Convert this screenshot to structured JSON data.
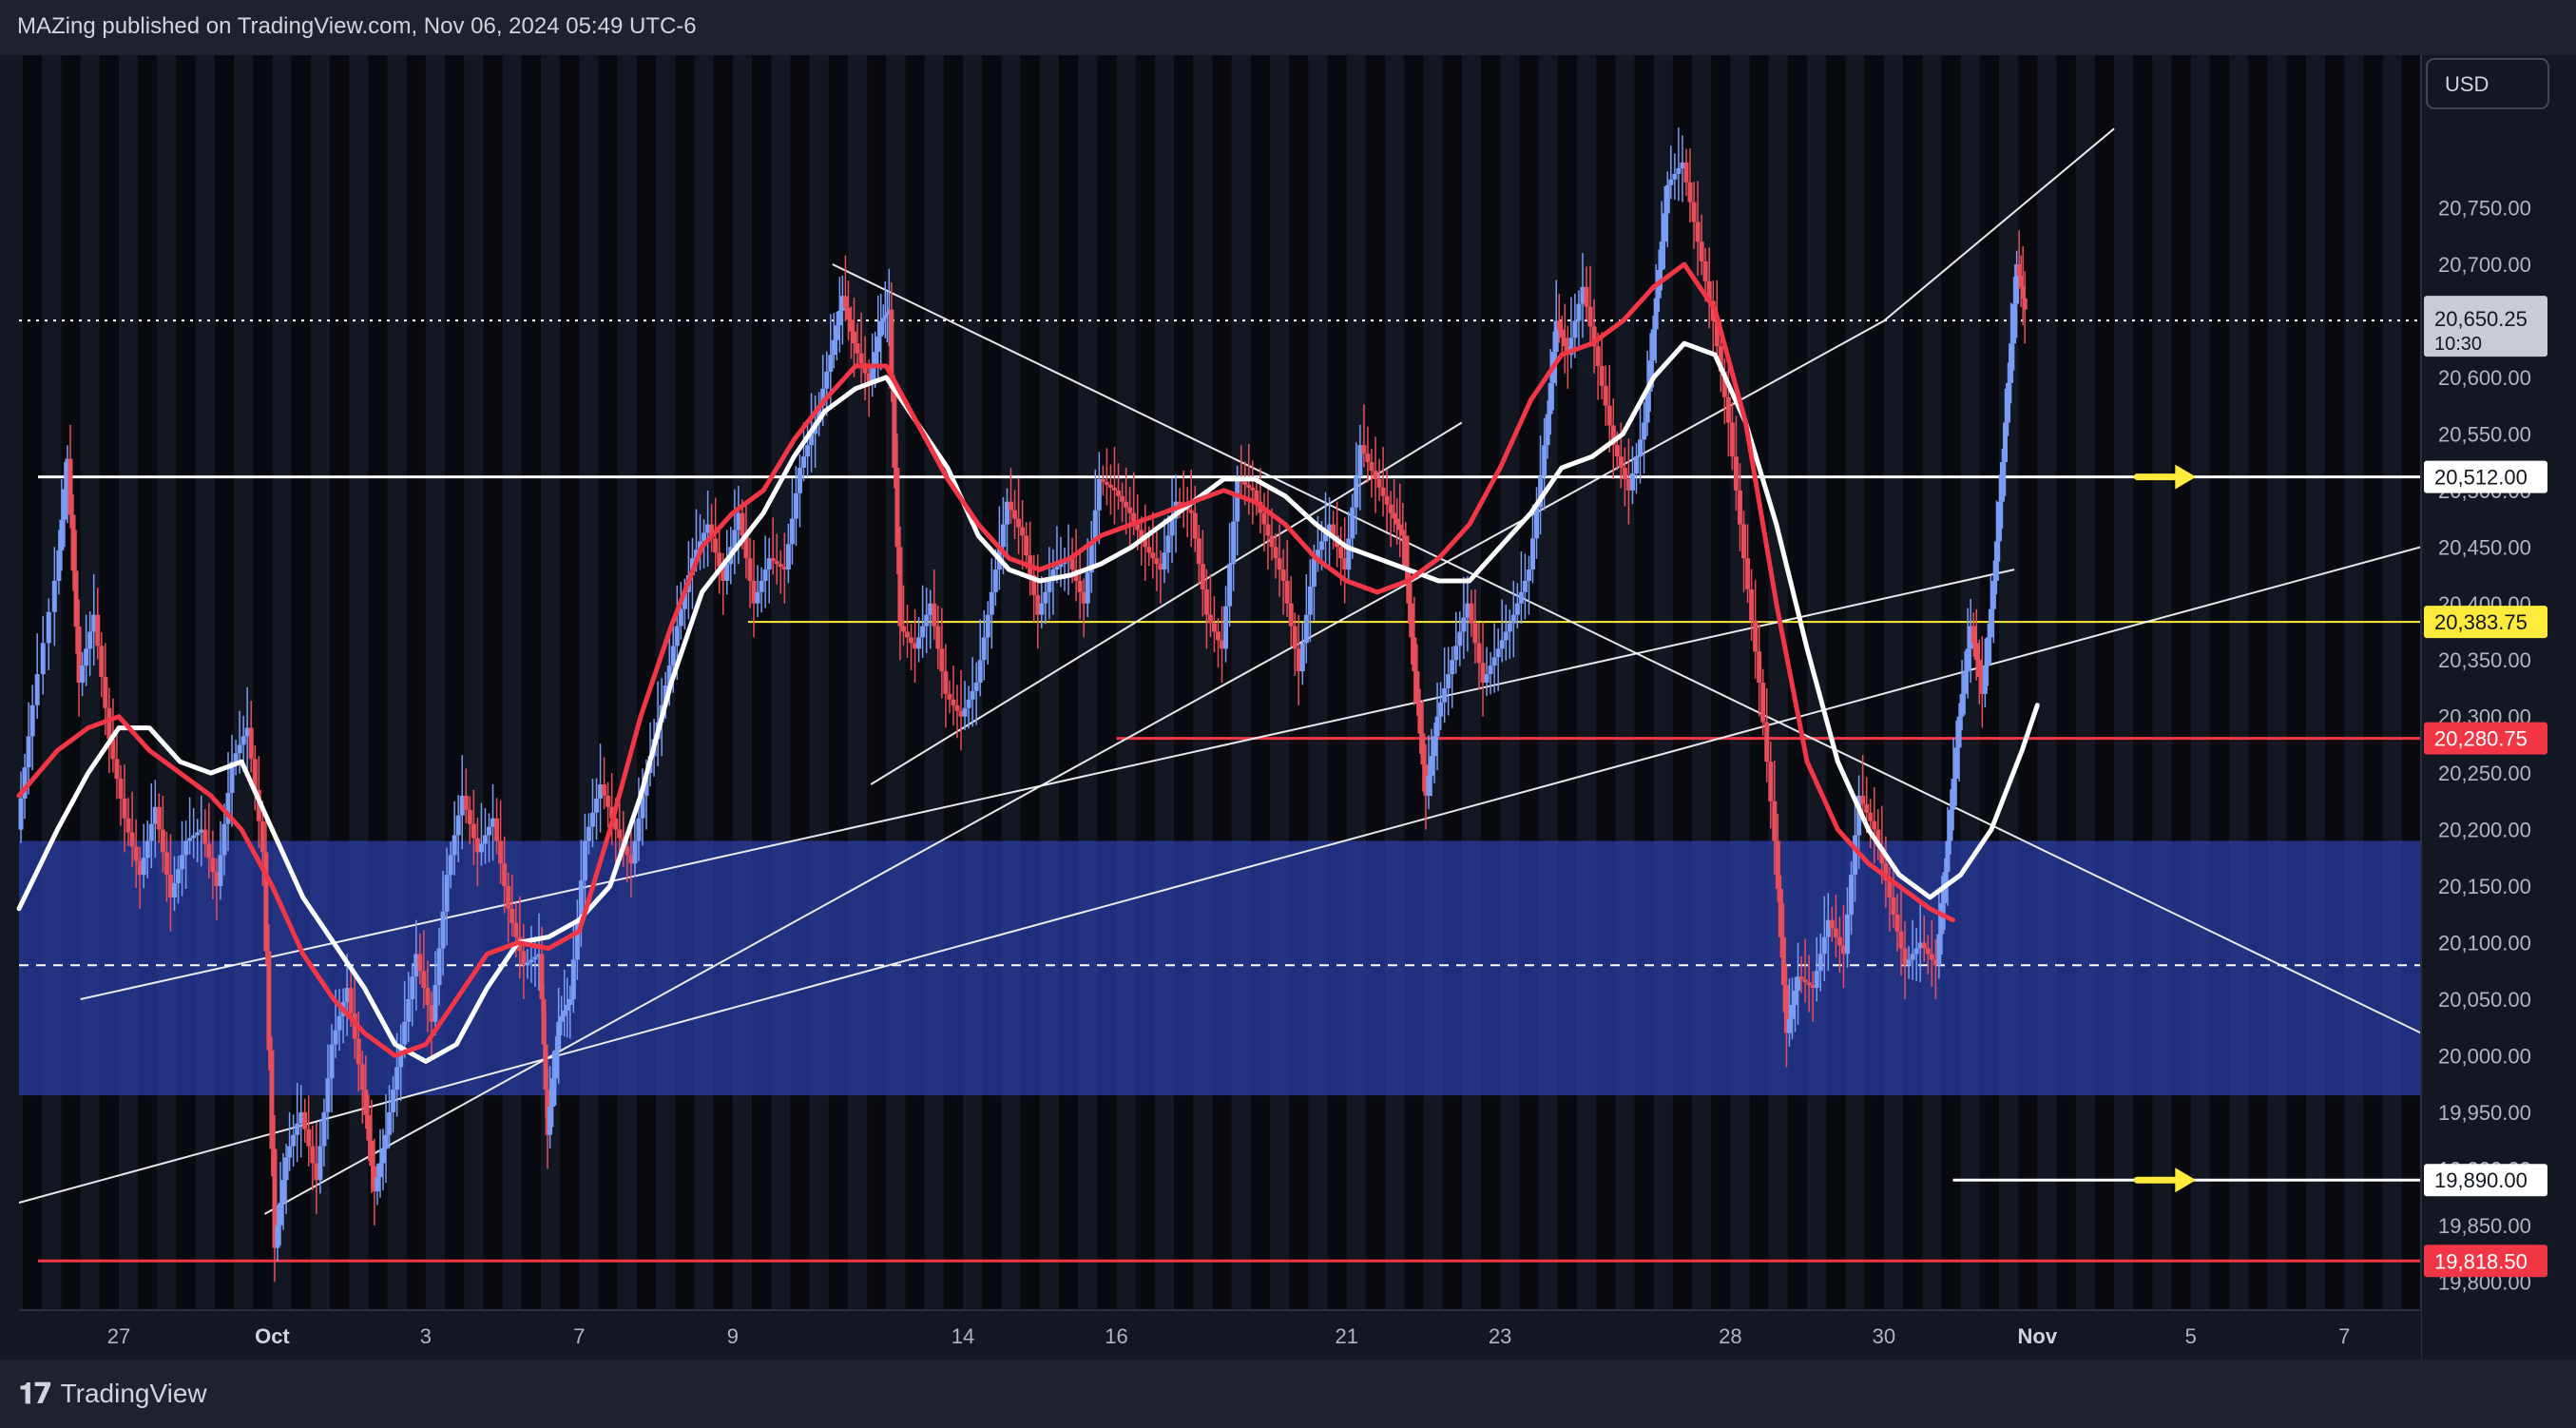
{
  "header": {
    "publisher": "MAZing published on TradingView.com, Nov 06, 2024 05:49 UTC-6"
  },
  "footer": {
    "brand": "TradingView",
    "logo_icon": "tradingview-logo-icon"
  },
  "chart_data": {
    "type": "candlestick",
    "title": "",
    "currency": "USD",
    "xlabel": "",
    "ylabel": "",
    "ylim": [
      19775,
      20885
    ],
    "y_ticks": [
      19800,
      19850,
      19900,
      19950,
      20000,
      20050,
      20100,
      20150,
      20200,
      20250,
      20300,
      20350,
      20400,
      20450,
      20500,
      20550,
      20600,
      20650,
      20700,
      20750
    ],
    "x_ticks": [
      {
        "label": "27",
        "t": 3
      },
      {
        "label": "Oct",
        "t": 5
      },
      {
        "label": "3",
        "t": 7
      },
      {
        "label": "7",
        "t": 9
      },
      {
        "label": "9",
        "t": 11
      },
      {
        "label": "14",
        "t": 14
      },
      {
        "label": "16",
        "t": 16
      },
      {
        "label": "21",
        "t": 19
      },
      {
        "label": "23",
        "t": 21
      },
      {
        "label": "28",
        "t": 24
      },
      {
        "label": "30",
        "t": 26
      },
      {
        "label": "Nov",
        "t": 28
      },
      {
        "label": "5",
        "t": 30
      },
      {
        "label": "7",
        "t": 32
      }
    ],
    "x_range": [
      1.7,
      33
    ],
    "grid": false,
    "session_stripes": true,
    "current_price": {
      "value": "20,650.25",
      "countdown": "10:30",
      "price": 20650.25
    },
    "price_series": [
      [
        1.7,
        20200
      ],
      [
        1.9,
        20310
      ],
      [
        2.2,
        20420
      ],
      [
        2.35,
        20528
      ],
      [
        2.5,
        20330
      ],
      [
        2.7,
        20390
      ],
      [
        2.9,
        20280
      ],
      [
        3.1,
        20210
      ],
      [
        3.3,
        20160
      ],
      [
        3.5,
        20220
      ],
      [
        3.7,
        20140
      ],
      [
        3.9,
        20190
      ],
      [
        4.1,
        20200
      ],
      [
        4.3,
        20150
      ],
      [
        4.5,
        20260
      ],
      [
        4.7,
        20290
      ],
      [
        4.9,
        20180
      ],
      [
        5.05,
        19830
      ],
      [
        5.2,
        19910
      ],
      [
        5.4,
        19950
      ],
      [
        5.6,
        19890
      ],
      [
        5.8,
        20010
      ],
      [
        6.0,
        20060
      ],
      [
        6.2,
        19970
      ],
      [
        6.35,
        19880
      ],
      [
        6.5,
        19930
      ],
      [
        6.7,
        20010
      ],
      [
        6.9,
        20090
      ],
      [
        7.1,
        20030
      ],
      [
        7.3,
        20160
      ],
      [
        7.5,
        20230
      ],
      [
        7.7,
        20180
      ],
      [
        7.9,
        20210
      ],
      [
        8.1,
        20130
      ],
      [
        8.3,
        20080
      ],
      [
        8.5,
        20090
      ],
      [
        8.6,
        19930
      ],
      [
        8.75,
        20030
      ],
      [
        8.9,
        20050
      ],
      [
        9.1,
        20190
      ],
      [
        9.3,
        20240
      ],
      [
        9.5,
        20200
      ],
      [
        9.7,
        20170
      ],
      [
        9.9,
        20250
      ],
      [
        10.1,
        20310
      ],
      [
        10.3,
        20380
      ],
      [
        10.5,
        20440
      ],
      [
        10.7,
        20470
      ],
      [
        10.9,
        20420
      ],
      [
        11.1,
        20480
      ],
      [
        11.3,
        20400
      ],
      [
        11.5,
        20440
      ],
      [
        11.7,
        20430
      ],
      [
        11.9,
        20520
      ],
      [
        12.1,
        20560
      ],
      [
        12.3,
        20620
      ],
      [
        12.45,
        20672
      ],
      [
        12.6,
        20630
      ],
      [
        12.8,
        20595
      ],
      [
        12.95,
        20650
      ],
      [
        13.05,
        20660
      ],
      [
        13.2,
        20380
      ],
      [
        13.4,
        20360
      ],
      [
        13.6,
        20400
      ],
      [
        13.8,
        20320
      ],
      [
        14.0,
        20300
      ],
      [
        14.2,
        20330
      ],
      [
        14.4,
        20410
      ],
      [
        14.6,
        20490
      ],
      [
        14.8,
        20460
      ],
      [
        15.0,
        20390
      ],
      [
        15.2,
        20430
      ],
      [
        15.4,
        20440
      ],
      [
        15.6,
        20400
      ],
      [
        15.8,
        20510
      ],
      [
        16.0,
        20500
      ],
      [
        16.2,
        20480
      ],
      [
        16.4,
        20450
      ],
      [
        16.6,
        20430
      ],
      [
        16.8,
        20490
      ],
      [
        17.0,
        20480
      ],
      [
        17.2,
        20390
      ],
      [
        17.4,
        20360
      ],
      [
        17.6,
        20510
      ],
      [
        17.8,
        20500
      ],
      [
        18.0,
        20460
      ],
      [
        18.2,
        20420
      ],
      [
        18.4,
        20340
      ],
      [
        18.6,
        20440
      ],
      [
        18.8,
        20470
      ],
      [
        19.0,
        20430
      ],
      [
        19.2,
        20540
      ],
      [
        19.4,
        20510
      ],
      [
        19.6,
        20480
      ],
      [
        19.75,
        20460
      ],
      [
        19.9,
        20340
      ],
      [
        20.05,
        20230
      ],
      [
        20.2,
        20300
      ],
      [
        20.4,
        20350
      ],
      [
        20.6,
        20400
      ],
      [
        20.8,
        20330
      ],
      [
        21.0,
        20360
      ],
      [
        21.2,
        20390
      ],
      [
        21.4,
        20430
      ],
      [
        21.6,
        20540
      ],
      [
        21.75,
        20650
      ],
      [
        21.9,
        20620
      ],
      [
        22.1,
        20680
      ],
      [
        22.3,
        20610
      ],
      [
        22.5,
        20540
      ],
      [
        22.7,
        20500
      ],
      [
        22.9,
        20560
      ],
      [
        23.05,
        20670
      ],
      [
        23.2,
        20770
      ],
      [
        23.4,
        20790
      ],
      [
        23.6,
        20720
      ],
      [
        23.8,
        20650
      ],
      [
        24.0,
        20560
      ],
      [
        24.2,
        20440
      ],
      [
        24.4,
        20330
      ],
      [
        24.6,
        20190
      ],
      [
        24.75,
        20020
      ],
      [
        24.9,
        20070
      ],
      [
        25.1,
        20060
      ],
      [
        25.3,
        20120
      ],
      [
        25.5,
        20090
      ],
      [
        25.7,
        20230
      ],
      [
        25.9,
        20200
      ],
      [
        26.1,
        20140
      ],
      [
        26.3,
        20080
      ],
      [
        26.5,
        20100
      ],
      [
        26.7,
        20080
      ],
      [
        26.85,
        20190
      ],
      [
        27.0,
        20300
      ],
      [
        27.15,
        20380
      ],
      [
        27.3,
        20320
      ],
      [
        27.45,
        20420
      ],
      [
        27.6,
        20560
      ],
      [
        27.75,
        20700
      ],
      [
        27.85,
        20660
      ]
    ],
    "moving_averages": [
      {
        "color": "#ffffff",
        "width": 5,
        "points": [
          [
            1.7,
            20130
          ],
          [
            2.2,
            20200
          ],
          [
            2.6,
            20250
          ],
          [
            3.0,
            20290
          ],
          [
            3.4,
            20290
          ],
          [
            3.8,
            20260
          ],
          [
            4.2,
            20250
          ],
          [
            4.6,
            20260
          ],
          [
            5.0,
            20200
          ],
          [
            5.4,
            20140
          ],
          [
            5.8,
            20100
          ],
          [
            6.2,
            20060
          ],
          [
            6.6,
            20010
          ],
          [
            7.0,
            19995
          ],
          [
            7.4,
            20010
          ],
          [
            7.8,
            20060
          ],
          [
            8.2,
            20100
          ],
          [
            8.6,
            20105
          ],
          [
            9.0,
            20120
          ],
          [
            9.4,
            20150
          ],
          [
            9.8,
            20230
          ],
          [
            10.2,
            20330
          ],
          [
            10.6,
            20410
          ],
          [
            11.0,
            20445
          ],
          [
            11.4,
            20480
          ],
          [
            11.8,
            20530
          ],
          [
            12.2,
            20570
          ],
          [
            12.6,
            20590
          ],
          [
            13.0,
            20600
          ],
          [
            13.4,
            20560
          ],
          [
            13.8,
            20520
          ],
          [
            14.2,
            20460
          ],
          [
            14.6,
            20430
          ],
          [
            15.0,
            20420
          ],
          [
            15.4,
            20425
          ],
          [
            15.8,
            20435
          ],
          [
            16.2,
            20450
          ],
          [
            16.6,
            20470
          ],
          [
            17.0,
            20490
          ],
          [
            17.4,
            20510
          ],
          [
            17.8,
            20510
          ],
          [
            18.2,
            20495
          ],
          [
            18.6,
            20470
          ],
          [
            19.0,
            20450
          ],
          [
            19.4,
            20440
          ],
          [
            19.8,
            20430
          ],
          [
            20.2,
            20420
          ],
          [
            20.6,
            20420
          ],
          [
            21.0,
            20450
          ],
          [
            21.4,
            20480
          ],
          [
            21.8,
            20520
          ],
          [
            22.2,
            20530
          ],
          [
            22.6,
            20550
          ],
          [
            23.0,
            20600
          ],
          [
            23.4,
            20630
          ],
          [
            23.8,
            20620
          ],
          [
            24.2,
            20560
          ],
          [
            24.6,
            20470
          ],
          [
            25.0,
            20360
          ],
          [
            25.4,
            20260
          ],
          [
            25.8,
            20200
          ],
          [
            26.2,
            20160
          ],
          [
            26.6,
            20140
          ],
          [
            27.0,
            20160
          ],
          [
            27.4,
            20200
          ],
          [
            27.8,
            20270
          ],
          [
            28.0,
            20310
          ]
        ]
      },
      {
        "color": "#f23645",
        "width": 5,
        "points": [
          [
            1.7,
            20230
          ],
          [
            2.2,
            20270
          ],
          [
            2.6,
            20290
          ],
          [
            3.0,
            20300
          ],
          [
            3.4,
            20270
          ],
          [
            3.8,
            20250
          ],
          [
            4.2,
            20230
          ],
          [
            4.6,
            20200
          ],
          [
            5.0,
            20150
          ],
          [
            5.4,
            20090
          ],
          [
            5.8,
            20050
          ],
          [
            6.2,
            20020
          ],
          [
            6.6,
            20000
          ],
          [
            7.0,
            20010
          ],
          [
            7.4,
            20050
          ],
          [
            7.8,
            20090
          ],
          [
            8.2,
            20100
          ],
          [
            8.6,
            20095
          ],
          [
            9.0,
            20110
          ],
          [
            9.4,
            20200
          ],
          [
            9.8,
            20300
          ],
          [
            10.2,
            20380
          ],
          [
            10.6,
            20450
          ],
          [
            11.0,
            20480
          ],
          [
            11.4,
            20500
          ],
          [
            11.8,
            20545
          ],
          [
            12.2,
            20580
          ],
          [
            12.6,
            20610
          ],
          [
            13.0,
            20610
          ],
          [
            13.4,
            20560
          ],
          [
            13.8,
            20510
          ],
          [
            14.2,
            20470
          ],
          [
            14.6,
            20440
          ],
          [
            15.0,
            20430
          ],
          [
            15.4,
            20440
          ],
          [
            15.8,
            20460
          ],
          [
            16.2,
            20470
          ],
          [
            16.6,
            20480
          ],
          [
            17.0,
            20490
          ],
          [
            17.4,
            20500
          ],
          [
            17.8,
            20490
          ],
          [
            18.2,
            20470
          ],
          [
            18.6,
            20440
          ],
          [
            19.0,
            20420
          ],
          [
            19.4,
            20410
          ],
          [
            19.8,
            20420
          ],
          [
            20.2,
            20440
          ],
          [
            20.6,
            20470
          ],
          [
            21.0,
            20520
          ],
          [
            21.4,
            20580
          ],
          [
            21.8,
            20620
          ],
          [
            22.2,
            20630
          ],
          [
            22.6,
            20650
          ],
          [
            23.0,
            20680
          ],
          [
            23.4,
            20700
          ],
          [
            23.8,
            20660
          ],
          [
            24.2,
            20560
          ],
          [
            24.6,
            20400
          ],
          [
            25.0,
            20260
          ],
          [
            25.4,
            20200
          ],
          [
            25.8,
            20170
          ],
          [
            26.2,
            20150
          ],
          [
            26.6,
            20130
          ],
          [
            26.9,
            20120
          ]
        ]
      }
    ],
    "levels": [
      {
        "label": "20,512.00",
        "price": 20512,
        "color": "#ffffff",
        "tag_bg": "#ffffff",
        "tag_fg": "#131722"
      },
      {
        "label": "20,383.75",
        "price": 20383.75,
        "color": "#ffeb3b",
        "tag_bg": "#ffeb3b",
        "tag_fg": "#131722"
      },
      {
        "label": "20,280.75",
        "price": 20280.75,
        "color": "#f23645",
        "tag_bg": "#f23645",
        "tag_fg": "#ffffff"
      },
      {
        "label": "19,890.00",
        "price": 19890,
        "color": "#ffffff",
        "tag_bg": "#ffffff",
        "tag_fg": "#131722"
      },
      {
        "label": "19,818.50",
        "price": 19818.5,
        "color": "#f23645",
        "tag_bg": "#f23645",
        "tag_fg": "#ffffff"
      }
    ],
    "zone": {
      "from": 19965,
      "to": 20190,
      "color": "#2a3fa8"
    },
    "dashed_level": 20080,
    "trendlines": [
      [
        [
          1.7,
          19870
        ],
        [
          33,
          20450
        ]
      ],
      [
        [
          4.9,
          19860
        ],
        [
          26.0,
          20650
        ],
        [
          29.0,
          20820
        ]
      ],
      [
        [
          2.5,
          20050
        ],
        [
          27.7,
          20430
        ]
      ],
      [
        [
          12.3,
          20700
        ],
        [
          33,
          20020
        ]
      ],
      [
        [
          12.8,
          20240
        ],
        [
          20.5,
          20560
        ]
      ]
    ],
    "arrows": [
      {
        "price": 20512,
        "color": "#ffeb3b"
      },
      {
        "price": 19890,
        "color": "#ffeb3b"
      }
    ]
  }
}
